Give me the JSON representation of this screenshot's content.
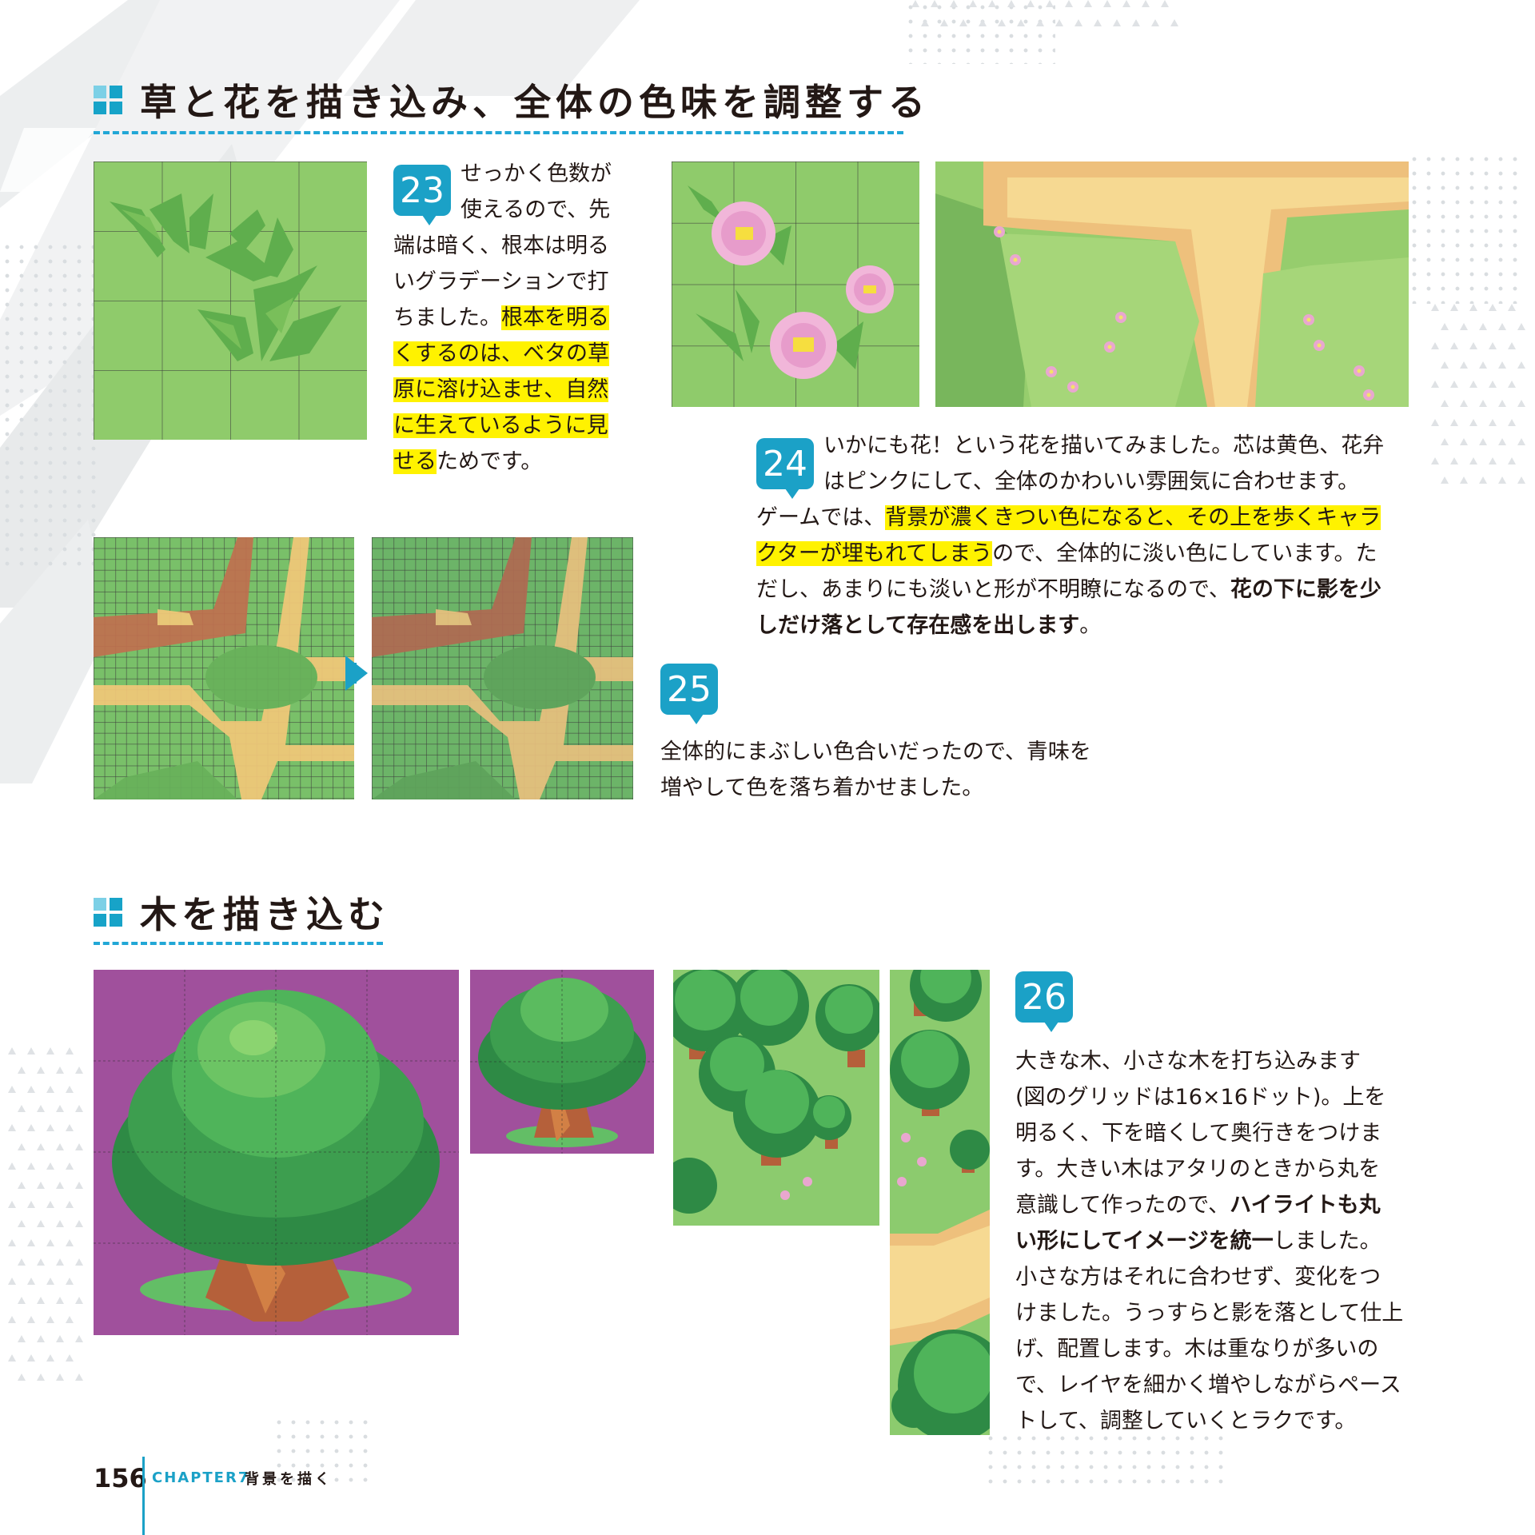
{
  "section1": {
    "heading": "草と花を描き込み、全体の色味を調整する"
  },
  "step23": {
    "number": "23",
    "lines": [
      {
        "parts": [
          {
            "t": "せっかく色数が"
          }
        ]
      },
      {
        "parts": [
          {
            "t": "使えるので、先"
          }
        ]
      },
      {
        "parts": [
          {
            "t": "端は暗く、根本は明る"
          }
        ]
      },
      {
        "parts": [
          {
            "t": "いグラデーションで打"
          }
        ]
      },
      {
        "parts": [
          {
            "t": "ちました。"
          },
          {
            "t": "根本を明る",
            "hl": true
          }
        ]
      },
      {
        "parts": [
          {
            "t": "くするのは、ベタの草",
            "hl": true
          }
        ]
      },
      {
        "parts": [
          {
            "t": "原に溶け込ませ、自然",
            "hl": true
          }
        ]
      },
      {
        "parts": [
          {
            "t": "に生えているように見",
            "hl": true
          }
        ]
      },
      {
        "parts": [
          {
            "t": "せる",
            "hl": true
          },
          {
            "t": "ためです。"
          }
        ]
      }
    ]
  },
  "step24": {
    "number": "24",
    "lines": [
      {
        "parts": [
          {
            "t": "いかにも花！という花を描いてみました。芯は黄色、花弁"
          }
        ]
      },
      {
        "parts": [
          {
            "t": "はピンクにして、全体のかわいい雰囲気に合わせます。"
          }
        ]
      },
      {
        "parts": [
          {
            "t": "ゲームでは、"
          },
          {
            "t": "背景が濃くきつい色になると、その上を歩くキャラ",
            "hl": true
          }
        ]
      },
      {
        "parts": [
          {
            "t": "クターが埋もれてしまう",
            "hl": true
          },
          {
            "t": "ので、全体的に淡い色にしています。た"
          }
        ]
      },
      {
        "parts": [
          {
            "t": "だし、あまりにも淡いと形が不明瞭になるので、"
          },
          {
            "t": "花の下に影を少",
            "b": true
          }
        ]
      },
      {
        "parts": [
          {
            "t": "しだけ落として存在感を出します",
            "b": true
          },
          {
            "t": "。"
          }
        ]
      }
    ]
  },
  "step25": {
    "number": "25",
    "lines": [
      {
        "parts": [
          {
            "t": "全体的にまぶしい色合いだったので、青味を"
          }
        ]
      },
      {
        "parts": [
          {
            "t": "増やして色を落ち着かせました。"
          }
        ]
      }
    ]
  },
  "section2": {
    "heading": "木を描き込む"
  },
  "step26": {
    "number": "26",
    "lines": [
      {
        "parts": [
          {
            "t": "大きな木、小さな木を打ち込みます"
          }
        ]
      },
      {
        "parts": [
          {
            "t": "(図のグリッドは16×16ドット)。上を"
          }
        ]
      },
      {
        "parts": [
          {
            "t": "明るく、下を暗くして奥行きをつけま"
          }
        ]
      },
      {
        "parts": [
          {
            "t": "す。大きい木はアタリのときから丸を"
          }
        ]
      },
      {
        "parts": [
          {
            "t": "意識して作ったので、"
          },
          {
            "t": "ハイライトも丸",
            "b": true
          }
        ]
      },
      {
        "parts": [
          {
            "t": "い形にしてイメージを統一",
            "b": true
          },
          {
            "t": "しました。"
          }
        ]
      },
      {
        "parts": [
          {
            "t": "小さな方はそれに合わせず、変化をつ"
          }
        ]
      },
      {
        "parts": [
          {
            "t": "けました。うっすらと影を落として仕上"
          }
        ]
      },
      {
        "parts": [
          {
            "t": "げ、配置します。木は重なりが多いの"
          }
        ]
      },
      {
        "parts": [
          {
            "t": "で、レイヤを細かく増やしながらペース"
          }
        ]
      },
      {
        "parts": [
          {
            "t": "トして、調整していくとラクです。"
          }
        ]
      }
    ]
  },
  "footer": {
    "page_number": "156",
    "chapter": "CHAPTER7",
    "chapter_title": "背景を描く"
  },
  "colors": {
    "accent": "#1ba1c7",
    "highlight": "#fff200",
    "grass": "#8fcb6b",
    "grass_dark": "#6bb35a",
    "path": "#f2c879",
    "dirt": "#c0704f",
    "magenta_bg": "#a0509c",
    "tree_green": "#3d9e4f",
    "trunk": "#b5603a"
  }
}
